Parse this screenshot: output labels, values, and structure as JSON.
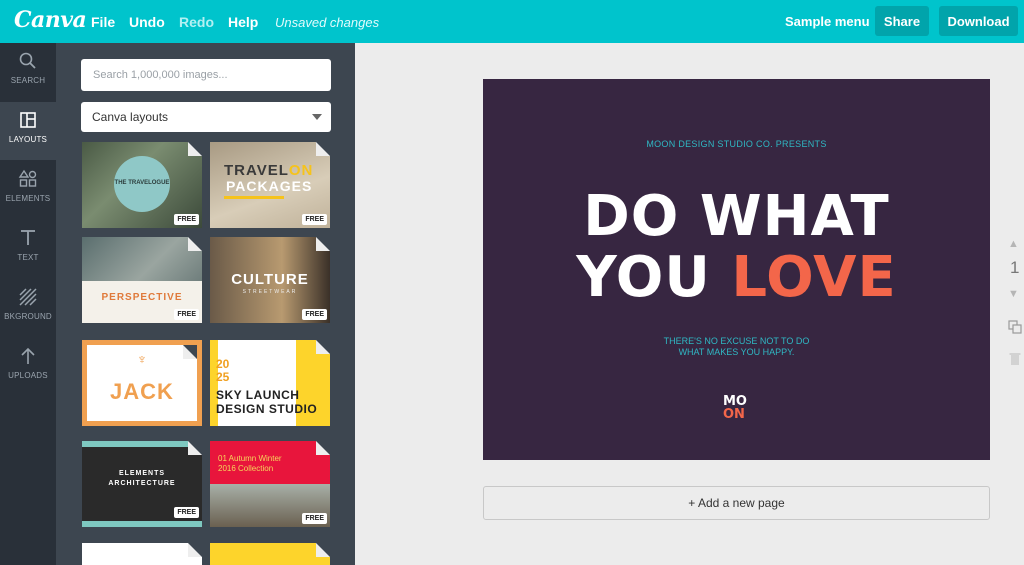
{
  "topbar": {
    "logo": "Canva",
    "menu": {
      "file": "File",
      "undo": "Undo",
      "redo": "Redo",
      "help": "Help"
    },
    "status": "Unsaved changes",
    "sample_menu": "Sample menu",
    "share": "Share",
    "download": "Download"
  },
  "rail": {
    "search": "SEARCH",
    "layouts": "LAYOUTS",
    "elements": "ELEMENTS",
    "text": "TEXT",
    "background": "BKGROUND",
    "uploads": "UPLOADS"
  },
  "panel": {
    "search_placeholder": "Search 1,000,000 images...",
    "dropdown_value": "Canva layouts",
    "free_label": "FREE",
    "thumbs": {
      "t1_a": "THE TRAVELOGUE",
      "t2_a": "TRAVEL",
      "t2_b": "ON",
      "t2_c": "PACKAGES",
      "t3_a": "PERSPECTIVE",
      "t4_a": "CULTURE",
      "t4_b": "STREETWEAR",
      "t5_a": "JACK",
      "t6_a": "20",
      "t6_b": "25",
      "t6_c": "SKY LAUNCH",
      "t6_d": "DESIGN STUDIO",
      "t7_a": "ELEMENTS",
      "t7_b": "ARCHITECTURE",
      "t8_a": "01 Autumn Winter",
      "t8_b": "2016 Collection"
    }
  },
  "design": {
    "presents": "MOON DESIGN STUDIO CO. PRESENTS",
    "line1": "DO WHAT",
    "line2a": "YOU ",
    "line2b": "LOVE",
    "tagline1": "THERE'S NO EXCUSE NOT TO DO",
    "tagline2": "WHAT MAKES YOU HAPPY.",
    "logo_top": "MO",
    "logo_bottom": "ON",
    "background_color": "#372641",
    "accent_color": "#f3664a"
  },
  "add_page": "+ Add a new page",
  "page_number": "1"
}
